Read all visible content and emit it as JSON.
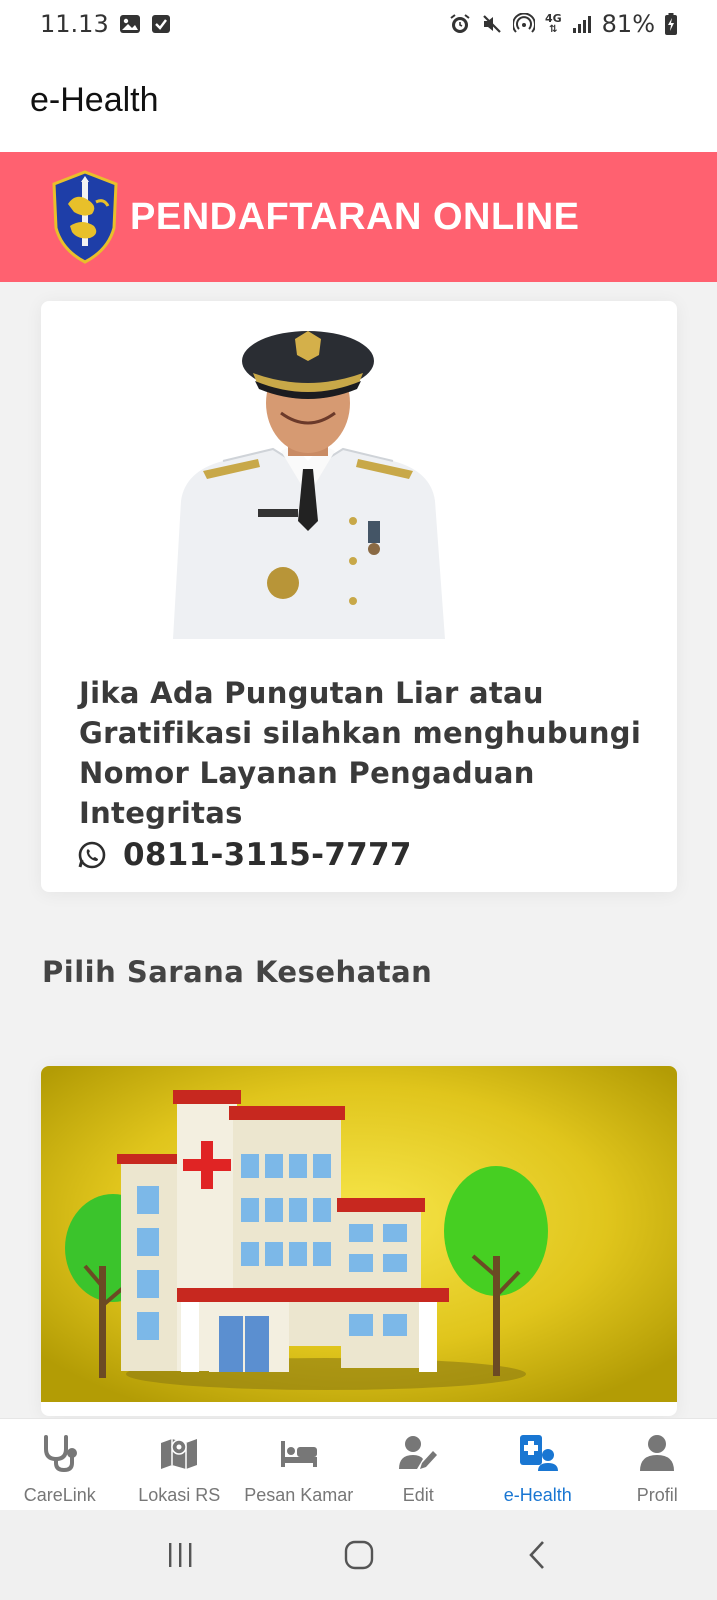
{
  "status_bar": {
    "time": "11.13",
    "network": "4G",
    "battery": "81%"
  },
  "app_bar": {
    "title": "e-Health"
  },
  "banner": {
    "title": "PENDAFTARAN ONLINE",
    "logo_icon": "surabaya-crest-icon",
    "background": "#ff6170"
  },
  "official_card": {
    "photo_icon": "official-portrait",
    "notice": "Jika Ada Pungutan Liar atau Gratifikasi silahkan menghubungi Nomor Layanan Pengaduan Integritas",
    "phone": "0811-3115-7777",
    "phone_icon": "whatsapp-icon"
  },
  "section": {
    "title": "Pilih Sarana Kesehatan"
  },
  "hospital_card": {
    "image_icon": "hospital-illustration"
  },
  "bottom_nav": {
    "items": [
      {
        "label": "CareLink",
        "icon": "stethoscope-icon"
      },
      {
        "label": "Lokasi RS",
        "icon": "map-icon"
      },
      {
        "label": "Pesan Kamar",
        "icon": "bed-icon"
      },
      {
        "label": "Edit",
        "icon": "user-edit-icon"
      },
      {
        "label": "e-Health",
        "icon": "medical-user-icon",
        "active": true
      },
      {
        "label": "Profil",
        "icon": "user-icon"
      }
    ],
    "active_color": "#1976d2",
    "inactive_color": "#777777"
  }
}
